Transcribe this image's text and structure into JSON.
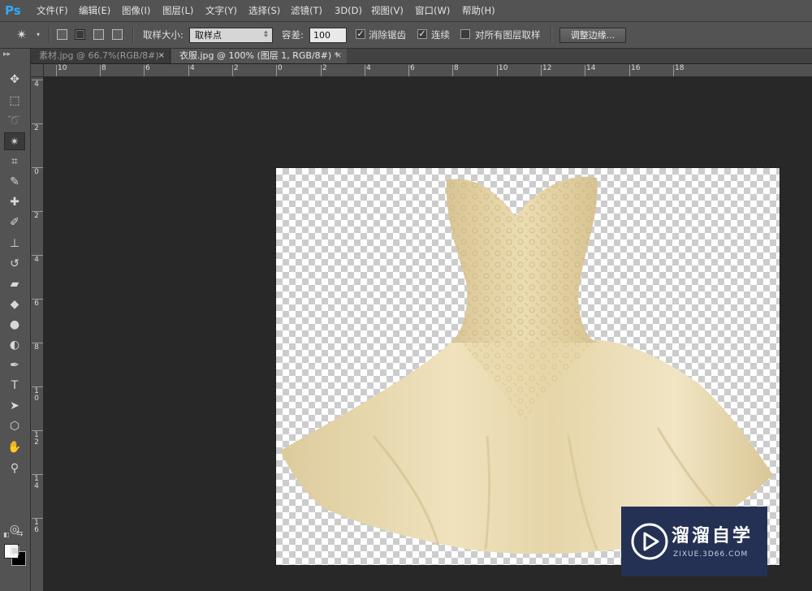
{
  "app": {
    "logo": "Ps"
  },
  "menu": [
    "文件(F)",
    "编辑(E)",
    "图像(I)",
    "图层(L)",
    "文字(Y)",
    "选择(S)",
    "滤镜(T)",
    "3D(D)",
    "视图(V)",
    "窗口(W)",
    "帮助(H)"
  ],
  "options": {
    "sample_size_label": "取样大小:",
    "sample_size_value": "取样点",
    "tolerance_label": "容差:",
    "tolerance_value": "100",
    "antialias_label": "消除锯齿",
    "antialias_checked": true,
    "contiguous_label": "连续",
    "contiguous_checked": true,
    "sample_all_layers_label": "对所有图层取样",
    "sample_all_layers_checked": false,
    "refine_edge_label": "调整边缘..."
  },
  "tabs": [
    {
      "label": "素材.jpg @ 66.7%(RGB/8#)",
      "close": "×",
      "active": false
    },
    {
      "label": "衣服.jpg @ 100% (图层 1, RGB/8#) *",
      "close": "×",
      "active": true
    }
  ],
  "hruler_labels": [
    "10",
    "8",
    "6",
    "4",
    "2",
    "0",
    "2",
    "4",
    "6",
    "8",
    "10",
    "12",
    "14",
    "16",
    "18"
  ],
  "vruler_labels": [
    "4",
    "2",
    "0",
    "2",
    "4",
    "6",
    "8",
    "10",
    "12",
    "14",
    "16"
  ],
  "tools": [
    {
      "name": "move-tool-icon",
      "glyph": "✥"
    },
    {
      "name": "marquee-tool-icon",
      "glyph": "⬚"
    },
    {
      "name": "lasso-tool-icon",
      "glyph": "➰"
    },
    {
      "name": "magic-wand-tool-icon",
      "glyph": "✴",
      "active": true
    },
    {
      "name": "crop-tool-icon",
      "glyph": "⌗"
    },
    {
      "name": "eyedropper-tool-icon",
      "glyph": "✎"
    },
    {
      "name": "healing-brush-tool-icon",
      "glyph": "✚"
    },
    {
      "name": "brush-tool-icon",
      "glyph": "✐"
    },
    {
      "name": "clone-stamp-tool-icon",
      "glyph": "⊥"
    },
    {
      "name": "history-brush-tool-icon",
      "glyph": "↺"
    },
    {
      "name": "eraser-tool-icon",
      "glyph": "▰"
    },
    {
      "name": "paint-bucket-tool-icon",
      "glyph": "◆"
    },
    {
      "name": "blur-tool-icon",
      "glyph": "●"
    },
    {
      "name": "dodge-tool-icon",
      "glyph": "◐"
    },
    {
      "name": "pen-tool-icon",
      "glyph": "✒"
    },
    {
      "name": "type-tool-icon",
      "glyph": "T"
    },
    {
      "name": "path-selection-tool-icon",
      "glyph": "➤"
    },
    {
      "name": "shape-tool-icon",
      "glyph": "⬡"
    },
    {
      "name": "hand-tool-icon",
      "glyph": "✋"
    },
    {
      "name": "zoom-tool-icon",
      "glyph": "⚲"
    }
  ],
  "bottom_tools": [
    {
      "name": "quick-mask-icon",
      "glyph": "◎"
    },
    {
      "name": "screen-mode-icon",
      "glyph": "▣"
    }
  ],
  "colors": {
    "foreground": "#ffffff",
    "background": "#000000"
  },
  "watermark": {
    "title": "溜溜自学",
    "url": "ZIXUE.3D66.COM"
  }
}
